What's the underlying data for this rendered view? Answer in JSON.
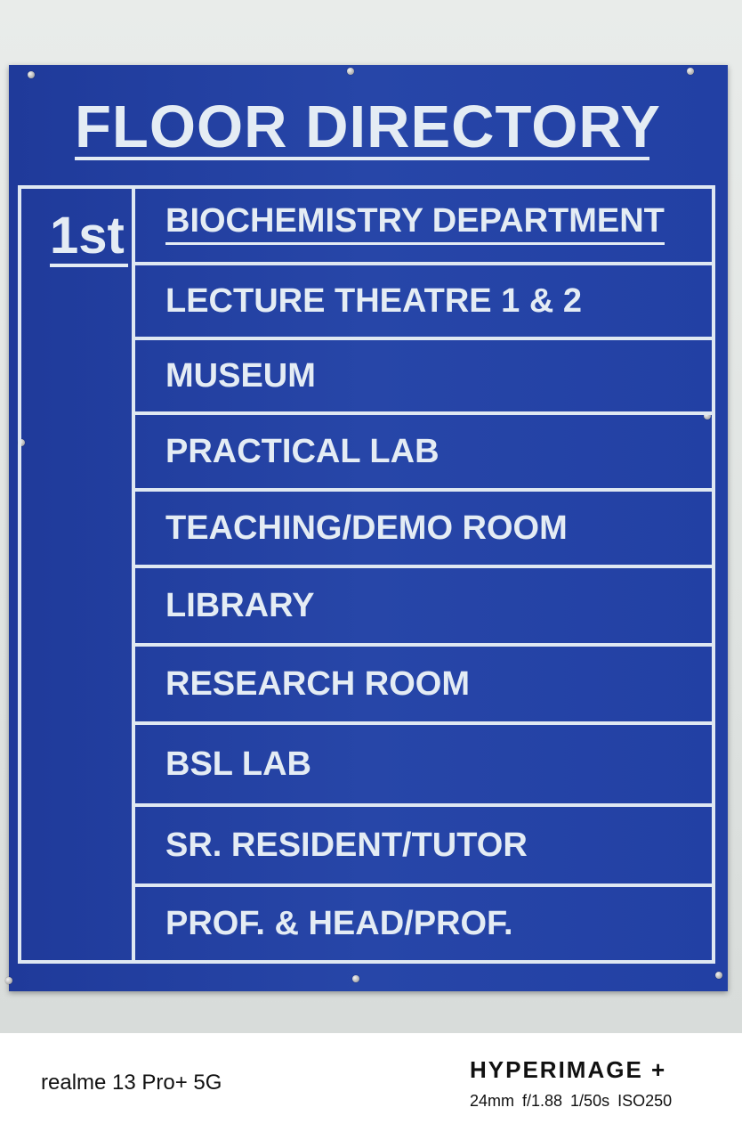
{
  "sign": {
    "title": "FLOOR DIRECTORY",
    "floor": "1st",
    "rooms": [
      "BIOCHEMISTRY DEPARTMENT",
      "LECTURE THEATRE 1 & 2",
      "MUSEUM",
      "PRACTICAL LAB",
      "TEACHING/DEMO ROOM",
      "LIBRARY",
      "RESEARCH ROOM",
      "BSL LAB",
      "SR. RESIDENT/TUTOR",
      "PROF. & HEAD/PROF."
    ],
    "colors": {
      "board": "#2443a6",
      "text": "#e4ecf4",
      "wall": "#e3e6e4"
    }
  },
  "watermark": {
    "device": "realme 13 Pro+ 5G",
    "brand": "HYPERIMAGE +",
    "specs": "24mm  f/1.88  1/50s  ISO250"
  }
}
